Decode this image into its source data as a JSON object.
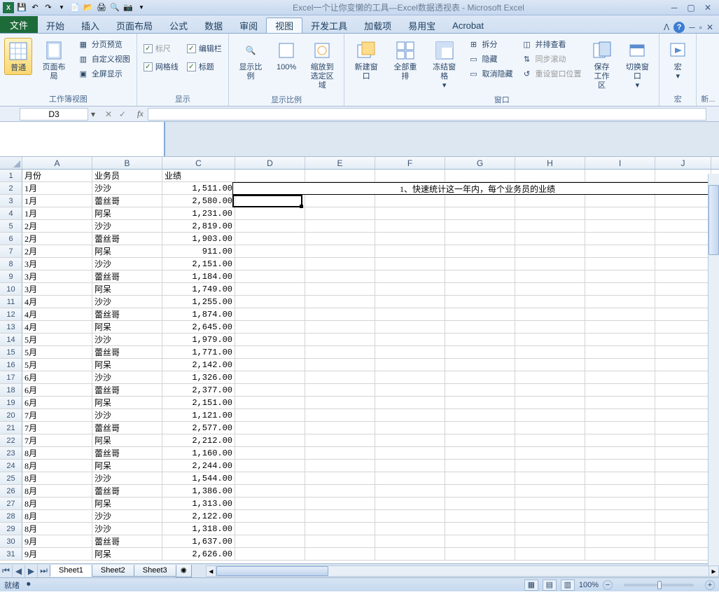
{
  "title": "Excel一个让你变懒的工具—Excel数据透视表 - Microsoft Excel",
  "tabs": {
    "file": "文件",
    "items": [
      "开始",
      "插入",
      "页面布局",
      "公式",
      "数据",
      "审阅",
      "视图",
      "开发工具",
      "加载项",
      "易用宝",
      "Acrobat"
    ],
    "active": "视图"
  },
  "ribbon": {
    "g1": {
      "label": "工作簿视图",
      "normal": "普通",
      "layout": "页面布局",
      "pagebreak": "分页预览",
      "custom": "自定义视图",
      "full": "全屏显示"
    },
    "g2": {
      "label": "显示",
      "ruler": "标尺",
      "formula": "编辑栏",
      "gridlines": "网格线",
      "headings": "标题"
    },
    "g3": {
      "label": "显示比例",
      "zoom": "显示比例",
      "hundred": "100%",
      "selection_l1": "缩放到",
      "selection_l2": "选定区域"
    },
    "g4": {
      "label": "窗口",
      "newwin": "新建窗口",
      "arrange": "全部重排",
      "freeze": "冻结窗格",
      "split": "拆分",
      "hide": "隐藏",
      "unhide": "取消隐藏",
      "sidebyside": "并排查看",
      "syncscroll": "同步滚动",
      "reset": "重设窗口位置",
      "savews": "保存",
      "savews2": "工作区",
      "switch": "切换窗口"
    },
    "g5": {
      "label": "宏",
      "macros": "宏"
    },
    "g6": {
      "label": "新..."
    }
  },
  "namebox": "D3",
  "headers": {
    "A": "月份",
    "B": "业务员",
    "C": "业绩"
  },
  "note": "1、快速统计这一年内，每个业务员的业绩",
  "rows": [
    {
      "n": 1,
      "a": "月份",
      "b": "业务员",
      "c": "业绩",
      "isHeader": true
    },
    {
      "n": 2,
      "a": "1月",
      "b": "沙沙",
      "c": "1,511.00"
    },
    {
      "n": 3,
      "a": "1月",
      "b": "蕾丝哥",
      "c": "2,580.00"
    },
    {
      "n": 4,
      "a": "1月",
      "b": "阿呆",
      "c": "1,231.00"
    },
    {
      "n": 5,
      "a": "2月",
      "b": "沙沙",
      "c": "2,819.00"
    },
    {
      "n": 6,
      "a": "2月",
      "b": "蕾丝哥",
      "c": "1,903.00"
    },
    {
      "n": 7,
      "a": "2月",
      "b": "阿呆",
      "c": "911.00"
    },
    {
      "n": 8,
      "a": "3月",
      "b": "沙沙",
      "c": "2,151.00"
    },
    {
      "n": 9,
      "a": "3月",
      "b": "蕾丝哥",
      "c": "1,184.00"
    },
    {
      "n": 10,
      "a": "3月",
      "b": "阿呆",
      "c": "1,749.00"
    },
    {
      "n": 11,
      "a": "4月",
      "b": "沙沙",
      "c": "1,255.00"
    },
    {
      "n": 12,
      "a": "4月",
      "b": "蕾丝哥",
      "c": "1,874.00"
    },
    {
      "n": 13,
      "a": "4月",
      "b": "阿呆",
      "c": "2,645.00"
    },
    {
      "n": 14,
      "a": "5月",
      "b": "沙沙",
      "c": "1,979.00"
    },
    {
      "n": 15,
      "a": "5月",
      "b": "蕾丝哥",
      "c": "1,771.00"
    },
    {
      "n": 16,
      "a": "5月",
      "b": "阿呆",
      "c": "2,142.00"
    },
    {
      "n": 17,
      "a": "6月",
      "b": "沙沙",
      "c": "1,326.00"
    },
    {
      "n": 18,
      "a": "6月",
      "b": "蕾丝哥",
      "c": "2,377.00"
    },
    {
      "n": 19,
      "a": "6月",
      "b": "阿呆",
      "c": "2,151.00"
    },
    {
      "n": 20,
      "a": "7月",
      "b": "沙沙",
      "c": "1,121.00"
    },
    {
      "n": 21,
      "a": "7月",
      "b": "蕾丝哥",
      "c": "2,577.00"
    },
    {
      "n": 22,
      "a": "7月",
      "b": "阿呆",
      "c": "2,212.00"
    },
    {
      "n": 23,
      "a": "8月",
      "b": "蕾丝哥",
      "c": "1,160.00"
    },
    {
      "n": 24,
      "a": "8月",
      "b": "阿呆",
      "c": "2,244.00"
    },
    {
      "n": 25,
      "a": "8月",
      "b": "沙沙",
      "c": "1,544.00"
    },
    {
      "n": 26,
      "a": "8月",
      "b": "蕾丝哥",
      "c": "1,386.00"
    },
    {
      "n": 27,
      "a": "8月",
      "b": "阿呆",
      "c": "1,313.00"
    },
    {
      "n": 28,
      "a": "8月",
      "b": "沙沙",
      "c": "2,122.00"
    },
    {
      "n": 29,
      "a": "8月",
      "b": "沙沙",
      "c": "1,318.00"
    },
    {
      "n": 30,
      "a": "9月",
      "b": "蕾丝哥",
      "c": "1,637.00"
    },
    {
      "n": 31,
      "a": "9月",
      "b": "阿呆",
      "c": "2,626.00"
    }
  ],
  "cols": [
    "A",
    "B",
    "C",
    "D",
    "E",
    "F",
    "G",
    "H",
    "I",
    "J"
  ],
  "sheets": {
    "s1": "Sheet1",
    "s2": "Sheet2",
    "s3": "Sheet3"
  },
  "status": {
    "ready": "就绪",
    "rec": "",
    "zoom": "100%"
  }
}
